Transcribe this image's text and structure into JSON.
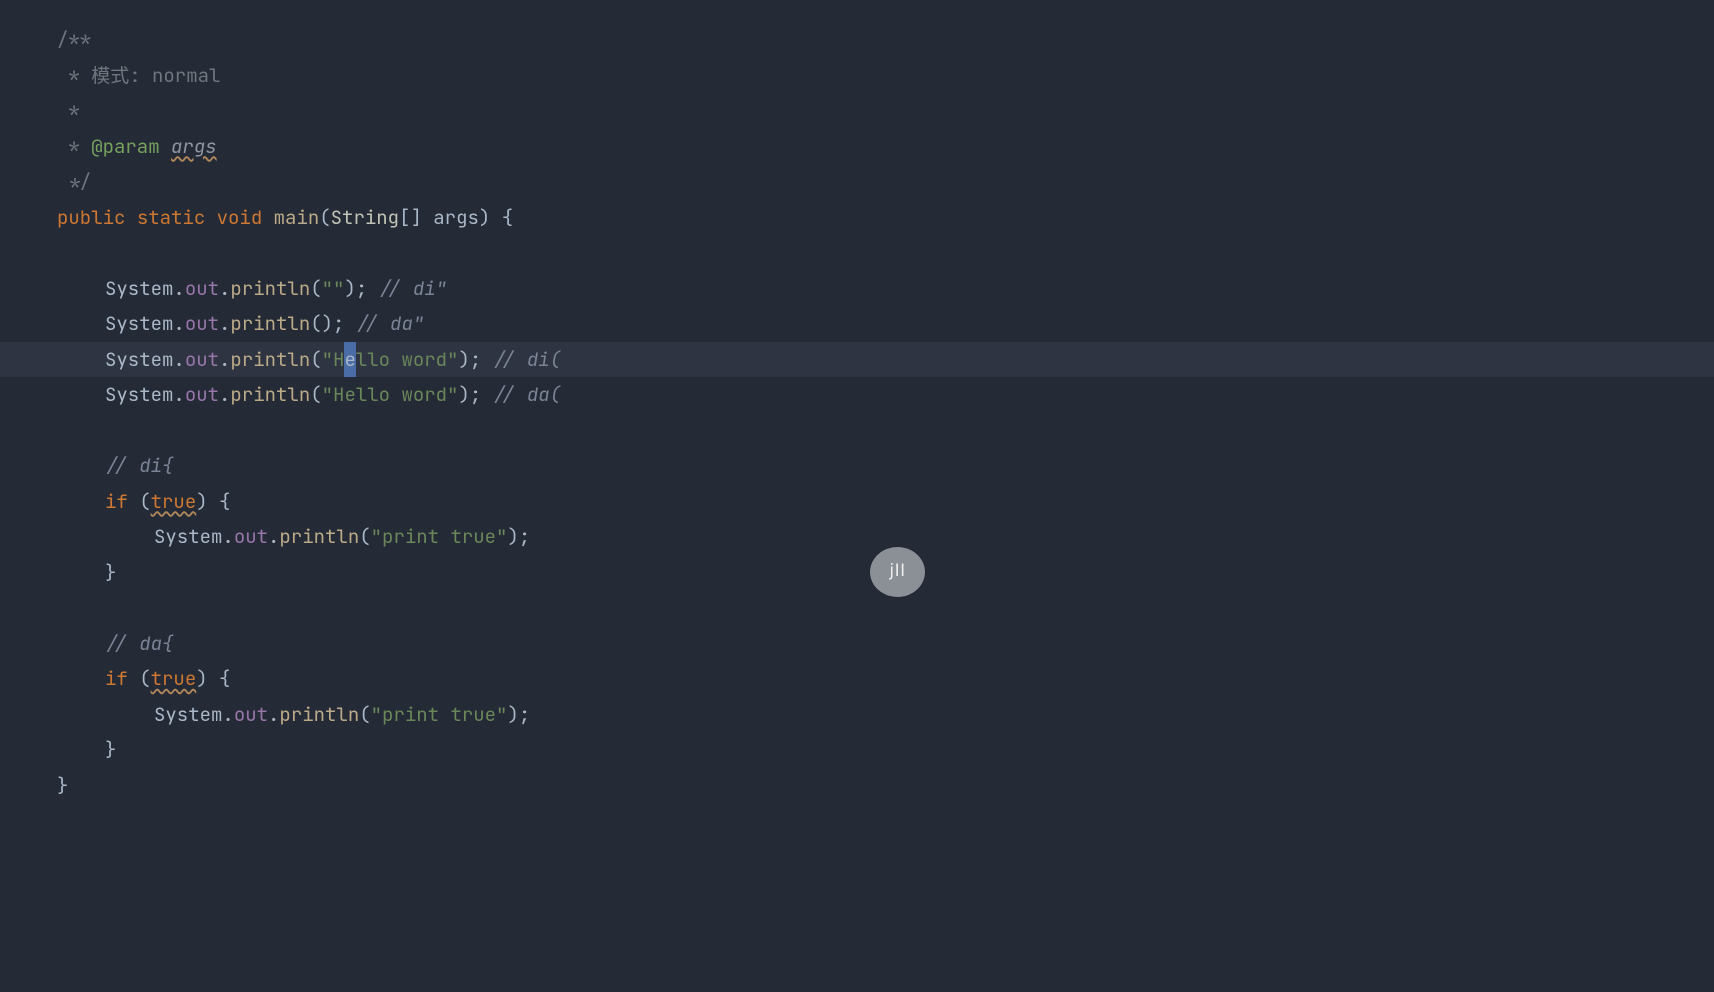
{
  "keyBubble": {
    "text": "jII"
  },
  "code": {
    "docOpen": "/**",
    "docLine1_prefix": " * ",
    "docLine1_text": "模式: normal",
    "docLine2": " *",
    "docLine3_prefix": " * ",
    "docLine3_tag": "@param",
    "docLine3_param": "args",
    "docClose": " */",
    "sig_public": "public",
    "sig_static": "static",
    "sig_void": "void",
    "sig_main": "main",
    "sig_paren_open": "(",
    "sig_type": "String",
    "sig_brackets": "[]",
    "sig_arg": " args",
    "sig_close": ") {",
    "sysout": "System",
    "dot": ".",
    "out": "out",
    "println": "println",
    "call1_open": "(",
    "call1_str": "\"\"",
    "call1_close": "); ",
    "c1": "// di\"",
    "call2_open": "(",
    "call2_close": "); ",
    "c2": "// da\"",
    "call3_open": "(",
    "str3_a": "\"H",
    "str3_sel": "e",
    "str3_b": "llo word\"",
    "call3_close": "); ",
    "c3": "// di(",
    "call4_open": "(",
    "str4": "\"Hello word\"",
    "call4_close": "); ",
    "c4": "// da(",
    "c5": "// di{",
    "if_kw": "if",
    "if_open": " (",
    "true_kw": "true",
    "if_close": ") {",
    "call5_open": "(",
    "str5": "\"print true\"",
    "call5_close": ");",
    "brace_close": "}",
    "c6": "// da{",
    "sp": " "
  }
}
